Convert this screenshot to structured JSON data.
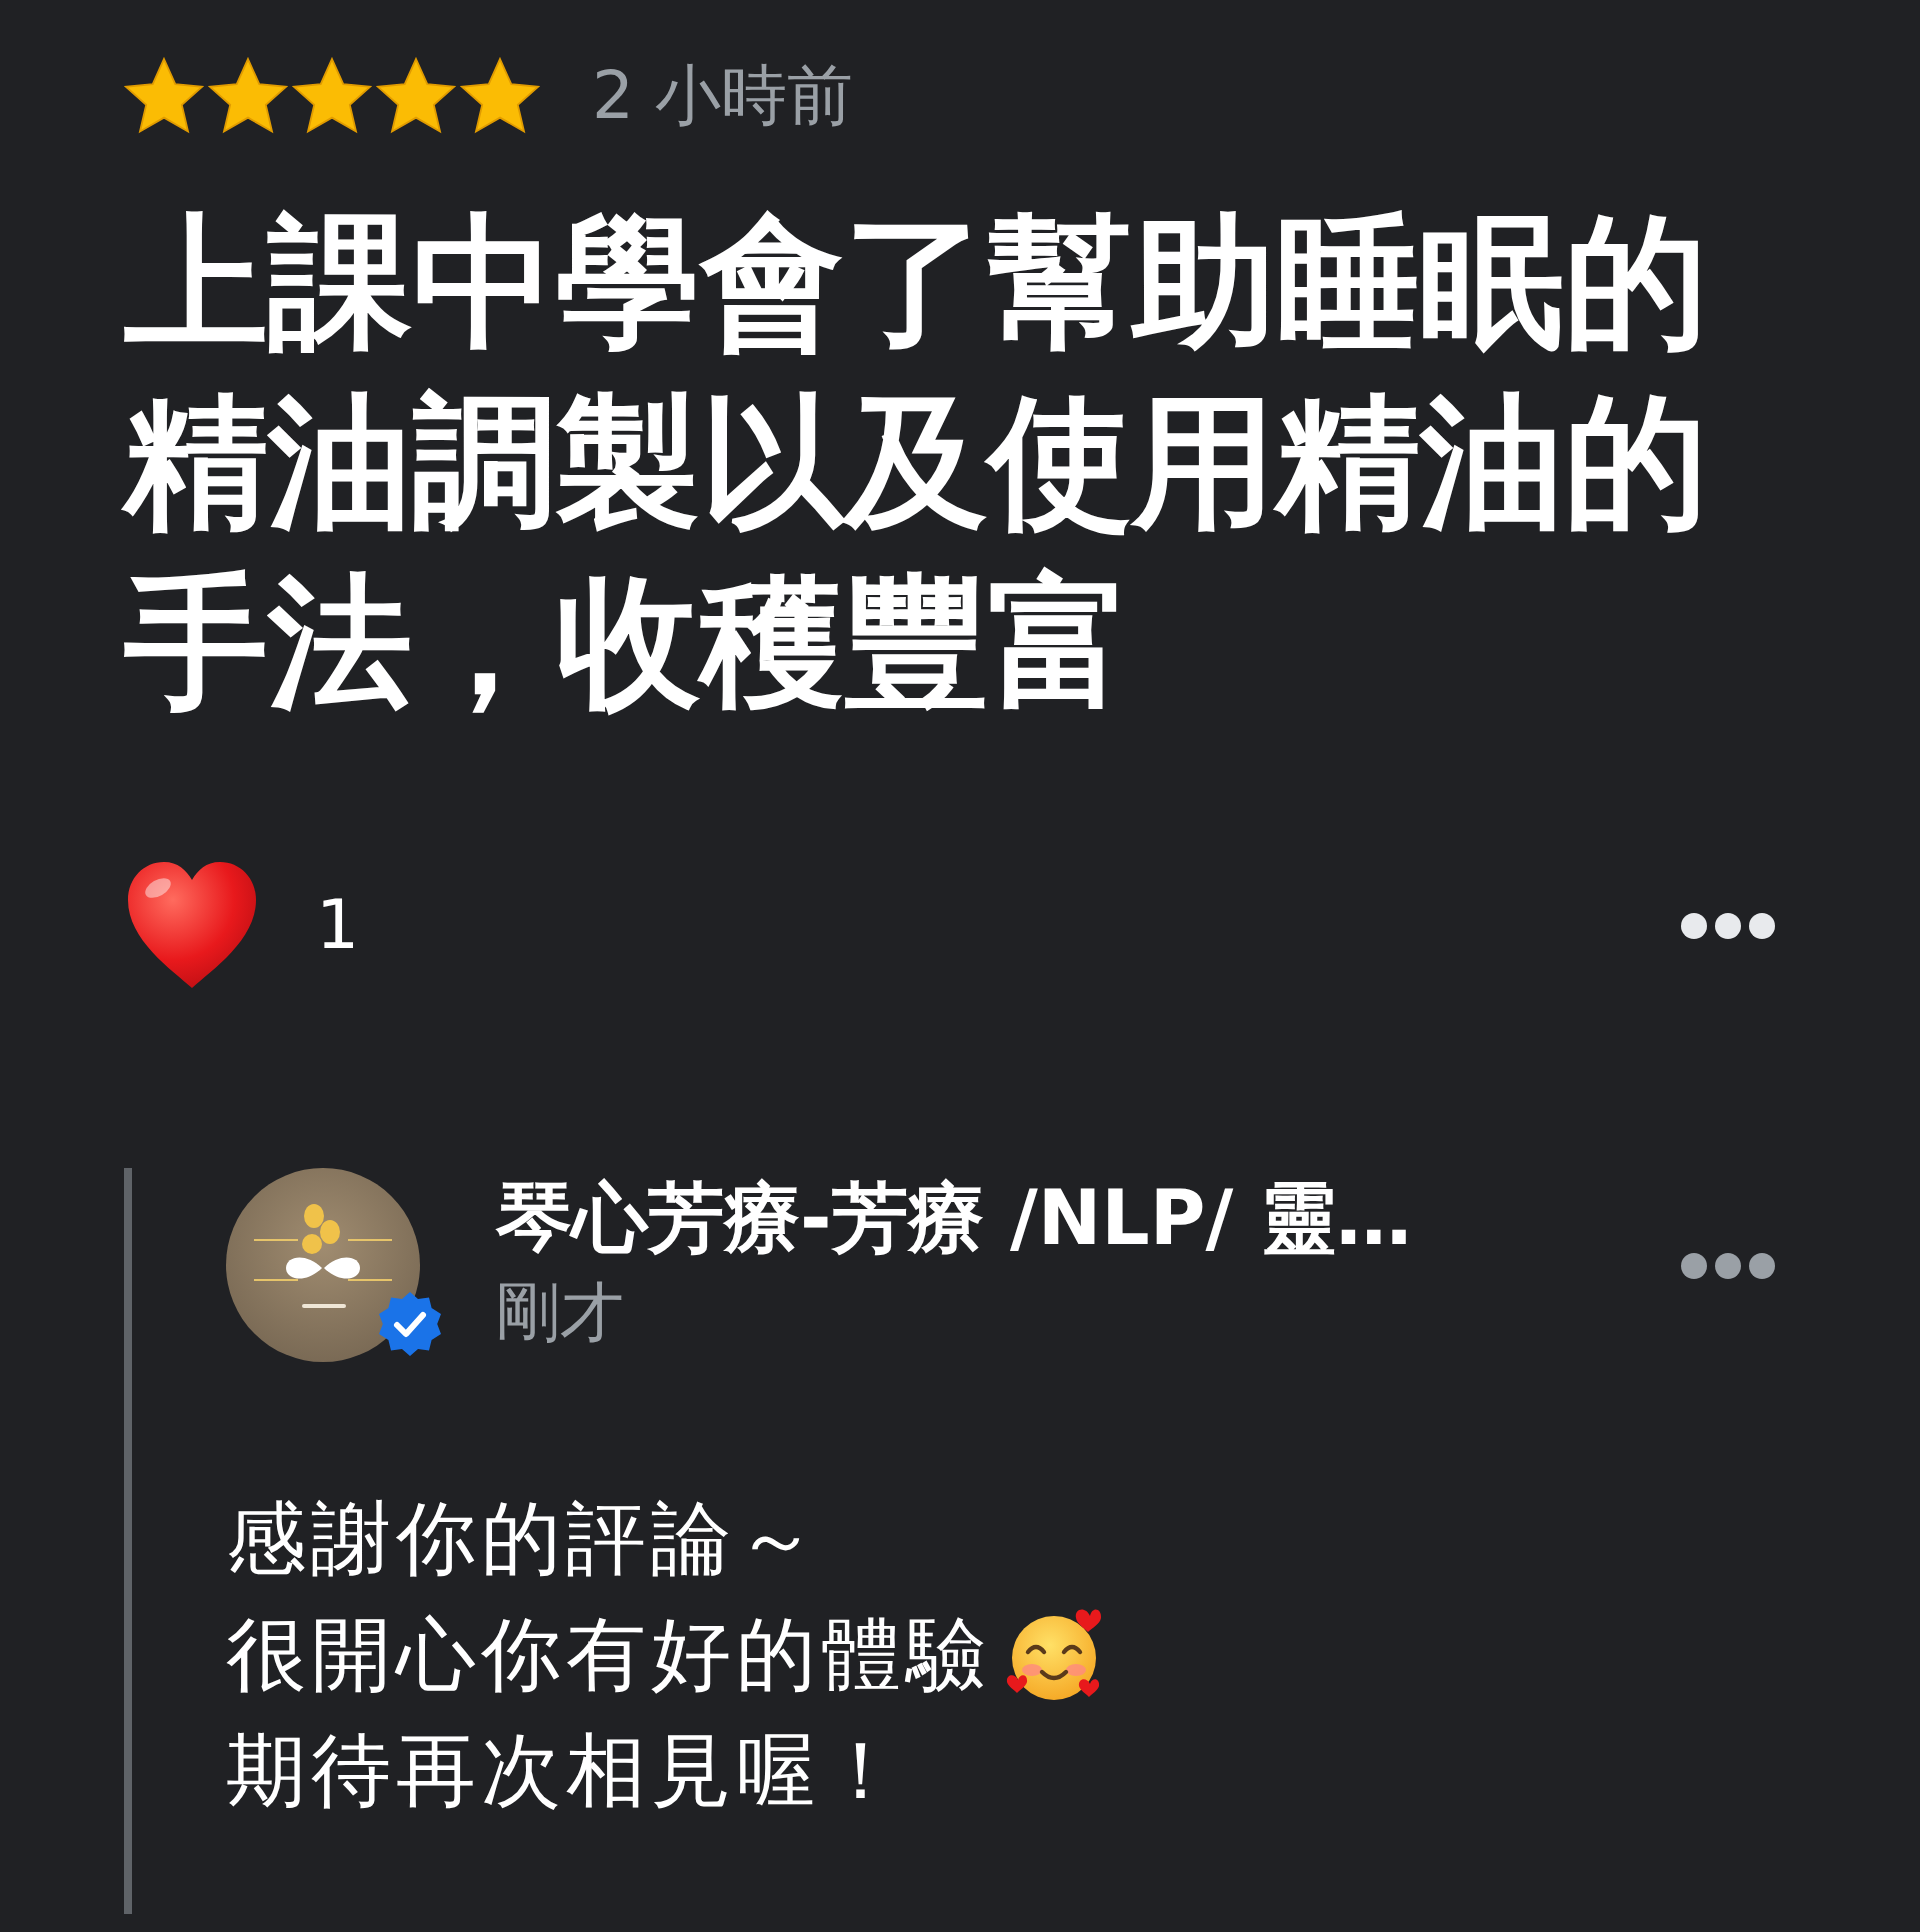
{
  "review": {
    "stars": 5,
    "time": "2 小時前",
    "text": "上課中學會了幫助睡眠的精油調製以及使用精油的手法，收穫豐富"
  },
  "reactions": {
    "count": "1"
  },
  "reply": {
    "author": "琴心芳療-芳療 /NLP/ 靈…",
    "verified": true,
    "time": "剛才",
    "lines": [
      {
        "text": "感謝你的評論～",
        "emoji": false
      },
      {
        "text": "很開心你有好的體驗",
        "emoji": true
      },
      {
        "text": "期待再次相見喔！",
        "emoji": false
      }
    ]
  }
}
